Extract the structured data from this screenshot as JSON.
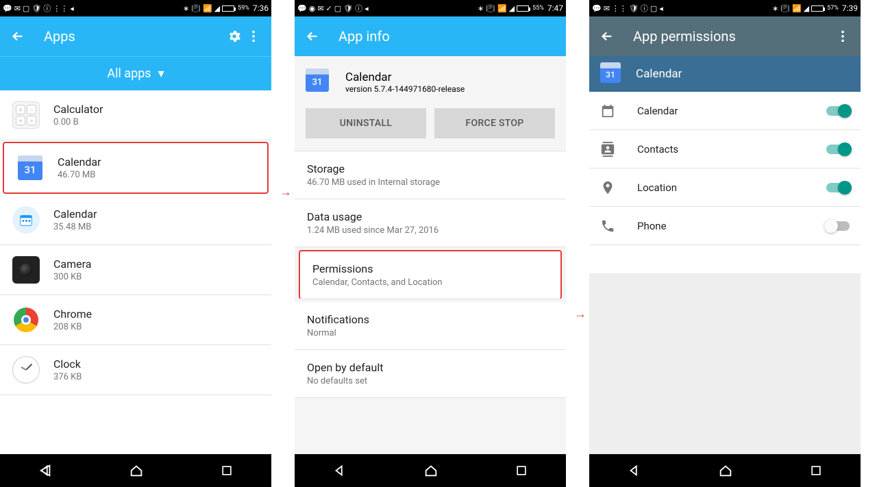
{
  "screen1": {
    "statusbar": {
      "battery": "59%",
      "time": "7:36"
    },
    "appbar": {
      "title": "Apps"
    },
    "filter": {
      "label": "All apps"
    },
    "apps": [
      {
        "name": "Calculator",
        "size": "0.00 B",
        "icon": "calculator"
      },
      {
        "name": "Calendar",
        "size": "46.70 MB",
        "icon": "gcal",
        "highlight": true
      },
      {
        "name": "Calendar",
        "size": "35.48 MB",
        "icon": "legacycal"
      },
      {
        "name": "Camera",
        "size": "300 KB",
        "icon": "camera"
      },
      {
        "name": "Chrome",
        "size": "208 KB",
        "icon": "chrome"
      },
      {
        "name": "Clock",
        "size": "376 KB",
        "icon": "clock"
      }
    ]
  },
  "screen2": {
    "statusbar": {
      "battery": "55%",
      "time": "7:47"
    },
    "appbar": {
      "title": "App info"
    },
    "app": {
      "name": "Calendar",
      "version": "version 5.7.4-144971680-release"
    },
    "buttons": {
      "uninstall": "UNINSTALL",
      "forcestop": "FORCE STOP"
    },
    "sections": [
      {
        "key": "storage",
        "title": "Storage",
        "sub": "46.70 MB used in Internal storage"
      },
      {
        "key": "datausage",
        "title": "Data usage",
        "sub": "1.24 MB used since Mar 27, 2016"
      },
      {
        "key": "permissions",
        "title": "Permissions",
        "sub": "Calendar, Contacts, and Location",
        "highlight": true
      },
      {
        "key": "notifications",
        "title": "Notifications",
        "sub": "Normal"
      },
      {
        "key": "openbydefault",
        "title": "Open by default",
        "sub": "No defaults set"
      }
    ]
  },
  "screen3": {
    "statusbar": {
      "battery": "57%",
      "time": "7:39"
    },
    "appbar": {
      "title": "App permissions"
    },
    "app": {
      "name": "Calendar"
    },
    "permissions": [
      {
        "name": "Calendar",
        "icon": "calendar-outline",
        "on": true
      },
      {
        "name": "Contacts",
        "icon": "contacts",
        "on": true
      },
      {
        "name": "Location",
        "icon": "location",
        "on": true
      },
      {
        "name": "Phone",
        "icon": "phone",
        "on": false
      }
    ]
  },
  "cal_day": "31"
}
